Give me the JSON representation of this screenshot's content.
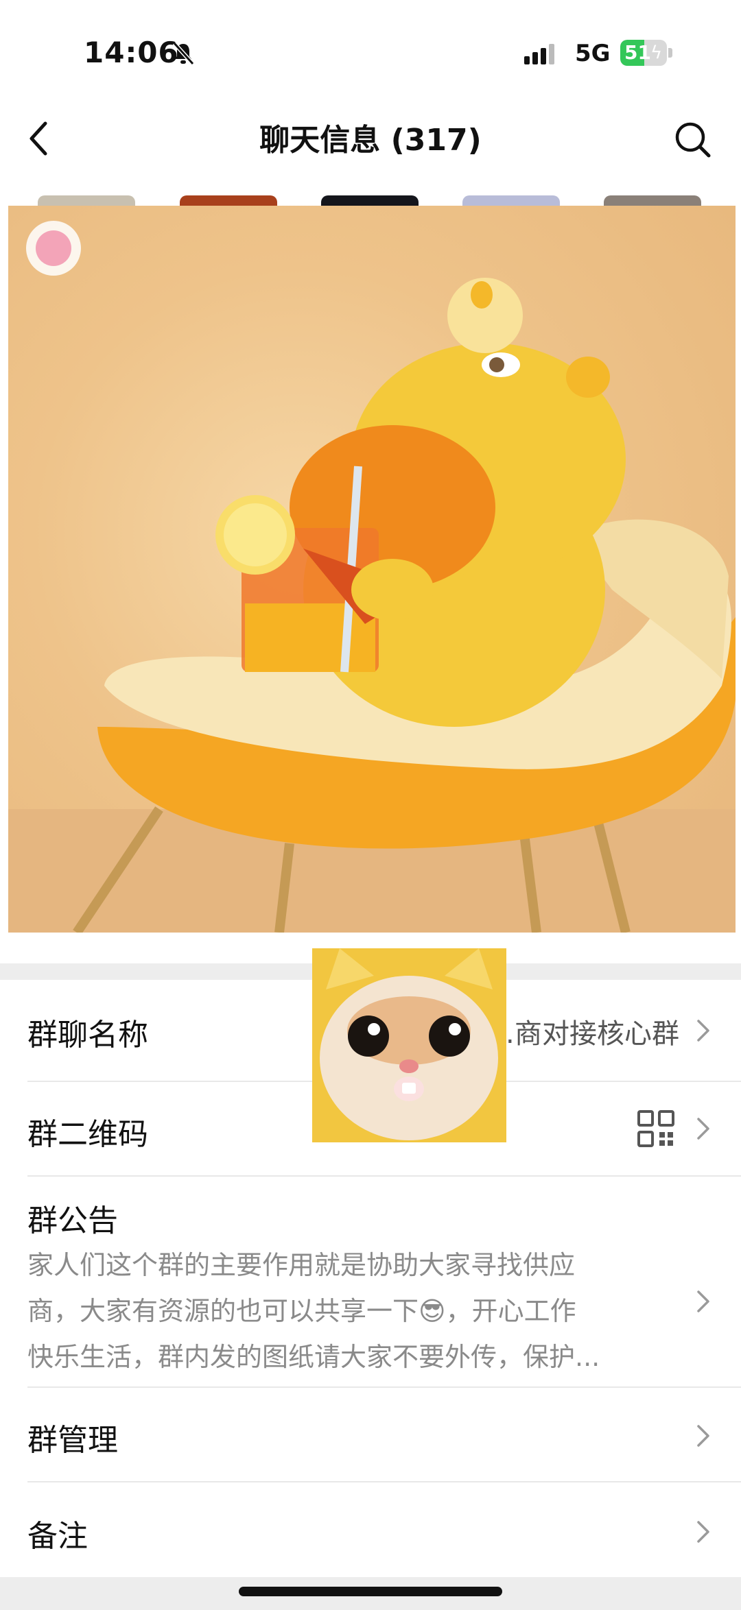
{
  "status_bar": {
    "time": "14:06",
    "network": "5G",
    "battery_level": "51",
    "battery_fraction": 0.51,
    "icons": [
      "bell-slash-icon",
      "signal-icon",
      "battery-charging-icon"
    ]
  },
  "nav": {
    "title": "聊天信息 (317)",
    "icons": [
      "chevron-left-icon",
      "search-icon"
    ]
  },
  "rows": {
    "group_name": {
      "label": "群聊名称",
      "value": "海…商对接核心群"
    },
    "group_qr": {
      "label": "群二维码",
      "icon": "qr-code-icon"
    },
    "announcement": {
      "label": "群公告",
      "line1": "家人们这个群的主要作用就是协助大家寻找供应",
      "line2": "商，大家有资源的也可以共享一下😎，开心工作",
      "line3": "快乐生活，群内发的图纸请大家不要外传，保护..."
    },
    "group_manage": {
      "label": "群管理"
    },
    "remark": {
      "label": "备注"
    }
  },
  "colors": {
    "battery_green": "#34c759",
    "sticker_orange": "#f5a623",
    "divider": "#e8e8e8",
    "muted_text": "#8a8a8a"
  }
}
